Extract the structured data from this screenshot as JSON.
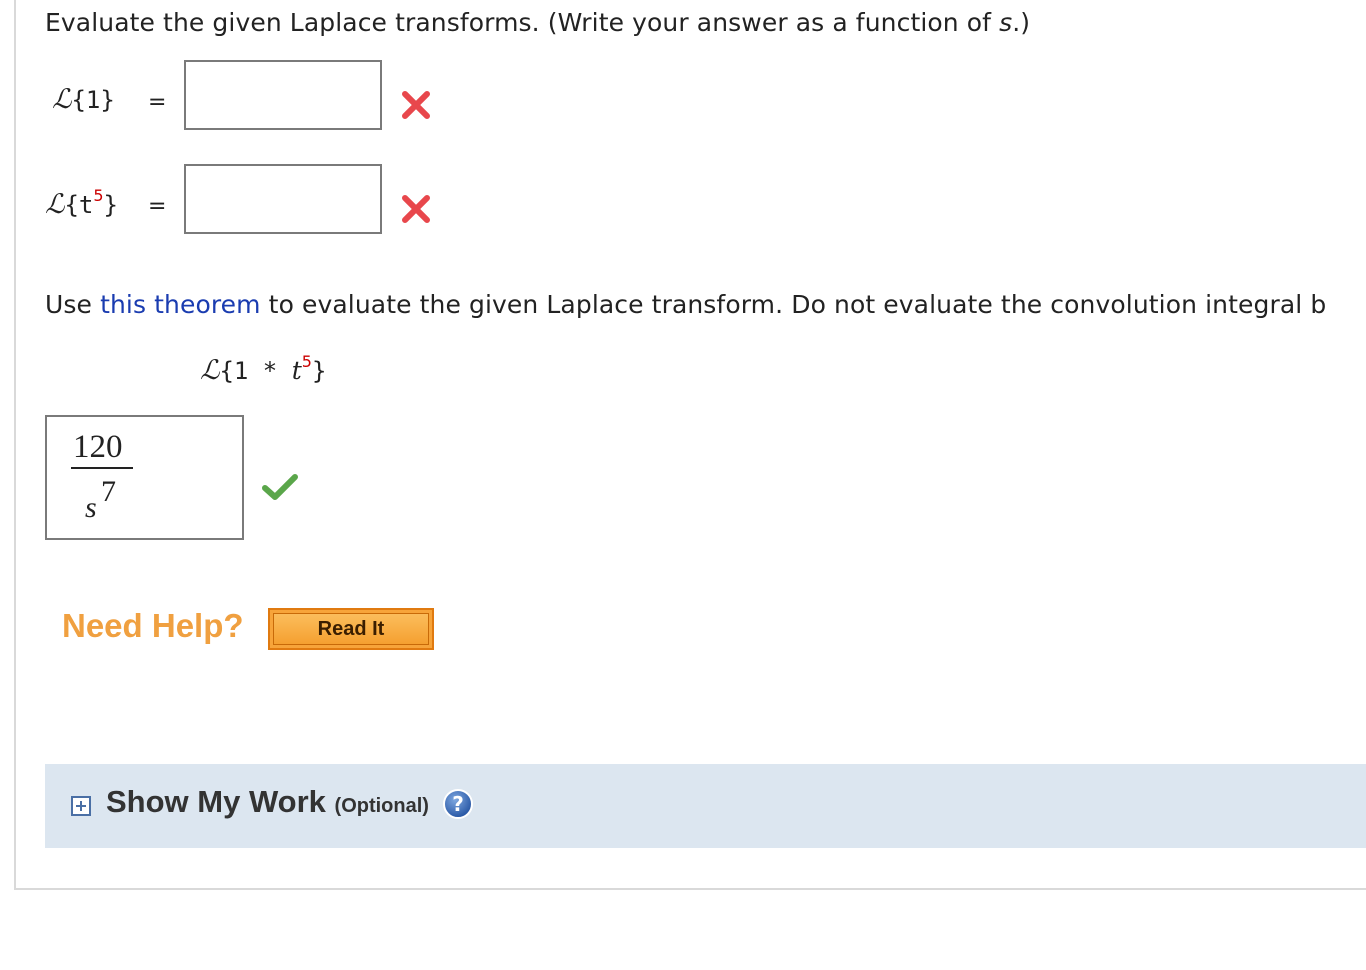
{
  "question": {
    "instruction1_pre": "Evaluate the given Laplace transforms. (Write your answer as a function of ",
    "instruction1_var": "s",
    "instruction1_post": ".)",
    "part1_lhs_symbol": "ℒ",
    "part1_lhs_body": "{1}",
    "part2_lhs_symbol": "ℒ",
    "part2_lhs_open": "{t",
    "part2_lhs_exp": "5",
    "part2_lhs_close": "}",
    "equals": "=",
    "part1_answer": "",
    "part2_answer": "",
    "instruction2_pre": "Use ",
    "instruction2_link": "this theorem",
    "instruction2_post": " to evaluate the given Laplace transform. Do not evaluate the convolution integral b",
    "conv_symbol": "ℒ",
    "conv_open": "{1 * ",
    "conv_t": "t",
    "conv_exp": "5",
    "conv_close": "}",
    "conv_answer_num": "120",
    "conv_answer_den": "s",
    "conv_answer_den_exp": "7"
  },
  "status": {
    "part1": "incorrect",
    "part2": "incorrect",
    "conv": "correct",
    "incorrect_color": "#e8474c",
    "correct_color": "#5aa64a"
  },
  "help": {
    "need_help": "Need Help?",
    "read_it": "Read It"
  },
  "show_my_work": {
    "title": "Show My Work",
    "optional": "(Optional)"
  }
}
